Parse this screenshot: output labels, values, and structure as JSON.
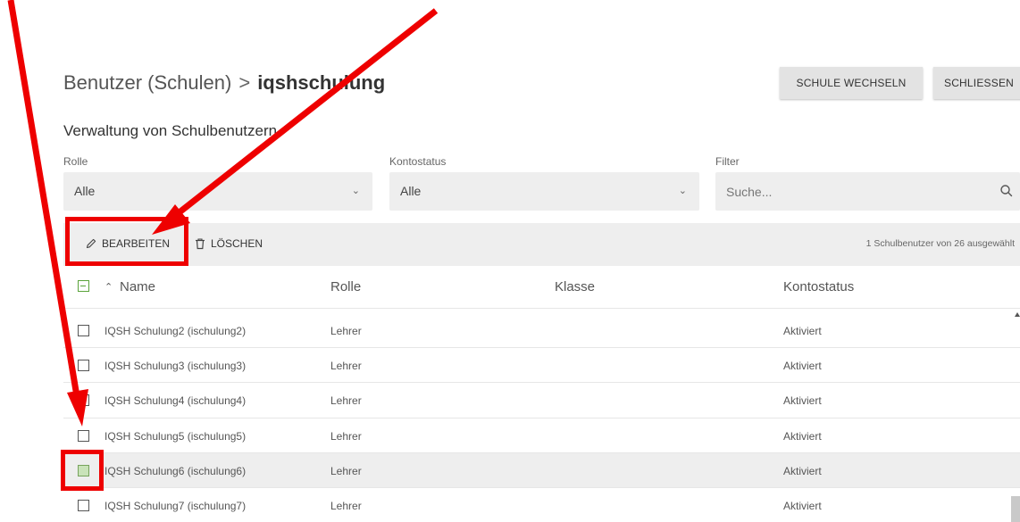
{
  "breadcrumb": {
    "root": "Benutzer (Schulen)",
    "separator": ">",
    "current": "iqshschulung"
  },
  "header_buttons": {
    "switch_school": "SCHULE WECHSELN",
    "close": "SCHLIESSEN"
  },
  "section_title": "Verwaltung von Schulbenutzern",
  "filters": {
    "role": {
      "label": "Rolle",
      "value": "Alle"
    },
    "status": {
      "label": "Kontostatus",
      "value": "Alle"
    },
    "search": {
      "label": "Filter",
      "placeholder": "Suche..."
    }
  },
  "toolbar": {
    "edit_label": "BEARBEITEN",
    "delete_label": "LÖSCHEN",
    "selection_info": "1 Schulbenutzer von 26 ausgewählt"
  },
  "columns": {
    "name": "Name",
    "role": "Rolle",
    "class": "Klasse",
    "status": "Kontostatus"
  },
  "rows": [
    {
      "name": "IQSH Schulung2 (ischulung2)",
      "role": "Lehrer",
      "class": "",
      "status": "Aktiviert",
      "checked": false
    },
    {
      "name": "IQSH Schulung3 (ischulung3)",
      "role": "Lehrer",
      "class": "",
      "status": "Aktiviert",
      "checked": false
    },
    {
      "name": "IQSH Schulung4 (ischulung4)",
      "role": "Lehrer",
      "class": "",
      "status": "Aktiviert",
      "checked": false
    },
    {
      "name": "IQSH Schulung5 (ischulung5)",
      "role": "Lehrer",
      "class": "",
      "status": "Aktiviert",
      "checked": false
    },
    {
      "name": "IQSH Schulung6 (ischulung6)",
      "role": "Lehrer",
      "class": "",
      "status": "Aktiviert",
      "checked": true
    },
    {
      "name": "IQSH Schulung7 (ischulung7)",
      "role": "Lehrer",
      "class": "",
      "status": "Aktiviert",
      "checked": false
    }
  ],
  "colors": {
    "annotation": "#ee0000",
    "checkbox_accent": "#5aa33a",
    "toolbar_bg": "#eeeeee"
  }
}
